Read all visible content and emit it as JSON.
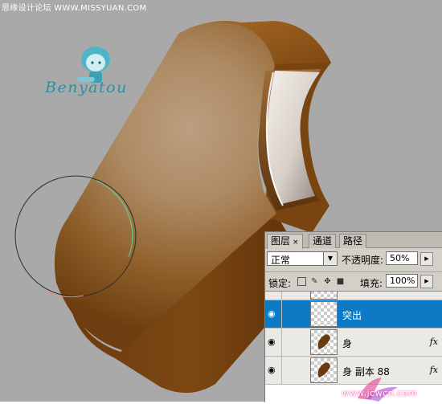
{
  "watermark": {
    "top_text": "思缘设计论坛 WWW.MISSYUAN.COM",
    "artist_signature": "Benyatou",
    "bottom_site": "www.jcwcn.com"
  },
  "brush_cursor": {
    "shape": "circle"
  },
  "layers_panel": {
    "tabs": [
      {
        "label": "图层",
        "active": true
      },
      {
        "label": "通道",
        "active": false
      },
      {
        "label": "路径",
        "active": false
      }
    ],
    "close_glyph": "×",
    "blend_mode": "正常",
    "opacity_label": "不透明度:",
    "opacity_value": "50%",
    "lock_label": "锁定:",
    "fill_label": "填充:",
    "fill_value": "100%",
    "fx_label": "fx",
    "layers": [
      {
        "name": "",
        "selected": false,
        "thumbnail": "transparent"
      },
      {
        "name": "突出",
        "selected": true,
        "thumbnail": "transparent"
      },
      {
        "name": "身",
        "selected": false,
        "thumbnail": "brown-shape",
        "has_fx": true
      },
      {
        "name": "身 副本 88",
        "selected": false,
        "thumbnail": "brown-shape",
        "has_fx": true
      }
    ]
  },
  "colors": {
    "canvas_bg": "#a9a9a9",
    "selection": "#0c7ac4",
    "ice_cream_light": "#b89a7c",
    "ice_cream_dark": "#6a3c12",
    "rim": "#8a5214",
    "panel_bg": "#d4d0c8"
  }
}
